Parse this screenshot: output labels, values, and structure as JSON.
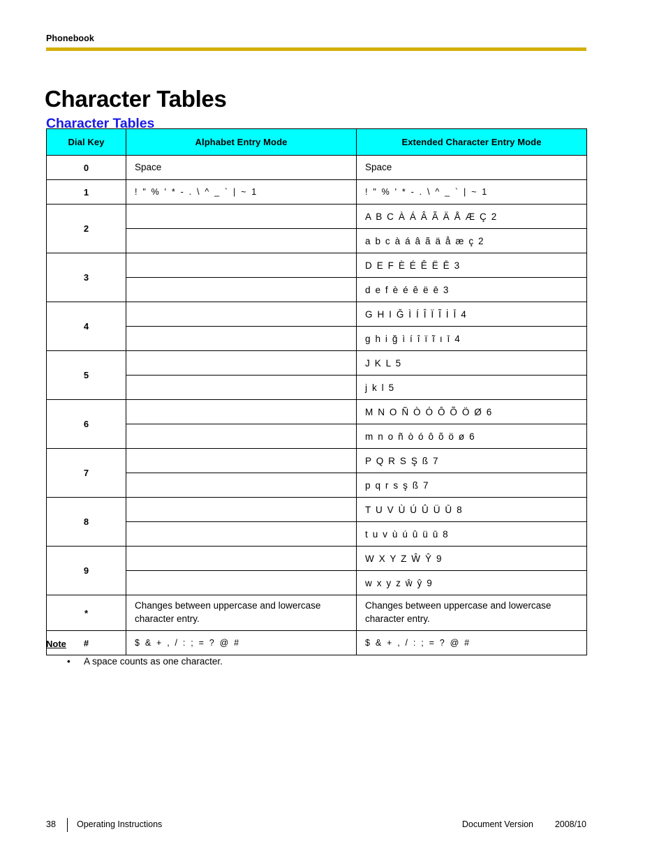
{
  "running_header": "Phonebook",
  "chapter_title": "Character Tables",
  "section_title": "Character Tables",
  "colors": {
    "header_rule": "#d4af0a",
    "table_header_bg": "#00ffff",
    "section_title": "#1b1be8",
    "table_border": "#000000"
  },
  "table": {
    "columns": [
      "Dial Key",
      "Alphabet Entry Mode",
      "Extended Character Entry Mode"
    ],
    "rows": [
      {
        "key": "0",
        "type": "single",
        "alphabet": "Space",
        "extended": "Space"
      },
      {
        "key": "1",
        "type": "single",
        "alphabet": "!  \"  %  '  *  -  .  \\  ^  _  `  |  ~  1",
        "extended": "!  \"  %  '  *  -  .  \\  ^  _  `  |  ~  1"
      },
      {
        "key": "2",
        "type": "split",
        "alphabet_upper": "",
        "alphabet_lower": "",
        "extended_upper": "A B C À Á Â Ã Ä Å Æ Ç 2",
        "extended_lower": "a b c à á â ã ä å æ ç 2"
      },
      {
        "key": "3",
        "type": "split",
        "alphabet_upper": "",
        "alphabet_lower": "",
        "extended_upper": "D E F È É Ê Ë Ē 3",
        "extended_lower": "d e f è é ê ë ē 3"
      },
      {
        "key": "4",
        "type": "split",
        "alphabet_upper": "",
        "alphabet_lower": "",
        "extended_upper": "G H I Ğ Ì Í Î Ï Ĩ İ Ī 4",
        "extended_lower": "g h i ğ ì í î ï ĩ ı ī 4"
      },
      {
        "key": "5",
        "type": "split",
        "alphabet_upper": "",
        "alphabet_lower": "",
        "extended_upper": "J K L 5",
        "extended_lower": "j k l 5"
      },
      {
        "key": "6",
        "type": "split",
        "alphabet_upper": "",
        "alphabet_lower": "",
        "extended_upper": "M N O Ñ Ò Ó Ô Õ Ö Ø 6",
        "extended_lower": "m n o ñ ò ó ô õ ö ø 6"
      },
      {
        "key": "7",
        "type": "split",
        "alphabet_upper": "",
        "alphabet_lower": "",
        "extended_upper": "P Q R S Ş ß 7",
        "extended_lower": "p q r s ş ß 7"
      },
      {
        "key": "8",
        "type": "split",
        "alphabet_upper": "",
        "alphabet_lower": "",
        "extended_upper": "T U V Ù Ú Û Ü Ū 8",
        "extended_lower": "t u v ù ú û ü ū 8"
      },
      {
        "key": "9",
        "type": "split",
        "alphabet_upper": "",
        "alphabet_lower": "",
        "extended_upper": "W X Y Z Ŵ Ŷ 9",
        "extended_lower": "w x y z ŵ ŷ 9"
      },
      {
        "key": "*",
        "type": "single",
        "alphabet": "Changes between uppercase and lowercase character entry.",
        "extended": "Changes between uppercase and lowercase character entry."
      },
      {
        "key": "#",
        "type": "single",
        "alphabet": "$  &  +  ,  /  :  ;  =  ?  @  #",
        "extended": "$  &  +  ,  /  :  ;  =  ?  @  #"
      }
    ]
  },
  "note": {
    "title": "Note",
    "bullet_glyph": "•",
    "items": [
      "A space counts as one character."
    ]
  },
  "footer": {
    "page_number": "38",
    "document_kind": "Operating Instructions",
    "document_version_label": "Document Version",
    "document_version_value": "2008/10"
  }
}
